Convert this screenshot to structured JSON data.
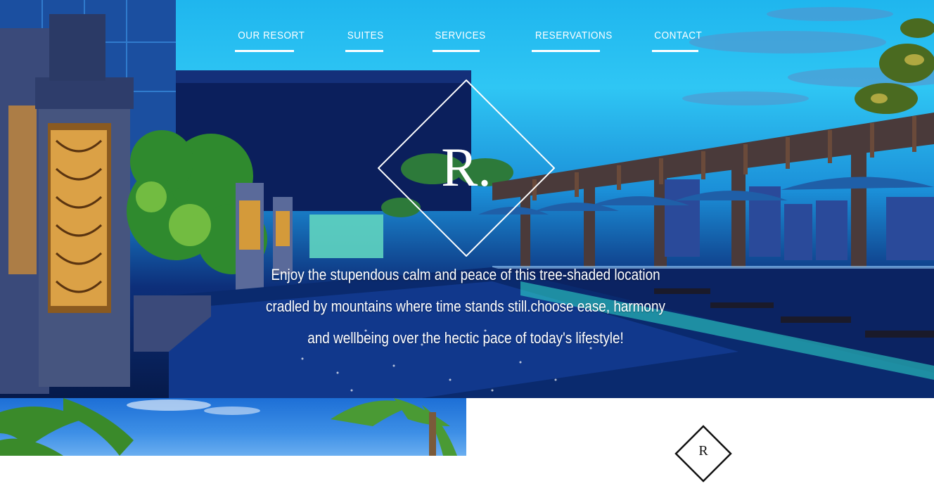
{
  "nav": {
    "items": [
      {
        "label": "OUR RESORT"
      },
      {
        "label": "SUITES"
      },
      {
        "label": "SERVICES"
      },
      {
        "label": "RESERVATIONS"
      },
      {
        "label": "CONTACT"
      }
    ]
  },
  "hero": {
    "logo_letter": "R.",
    "tagline": {
      "line1": "Enjoy the stupendous calm and peace of this tree-shaded location",
      "line2": "cradled by mountains where time stands still.choose ease, harmony",
      "line3": "and wellbeing over the hectic pace of today's lifestyle!"
    }
  },
  "lower": {
    "logo_letter": "R"
  },
  "colors": {
    "nav_text": "#ffffff",
    "sky": "#2fc6f4",
    "pool": "#0a2a6e",
    "panel_bg": "#ffffff"
  }
}
